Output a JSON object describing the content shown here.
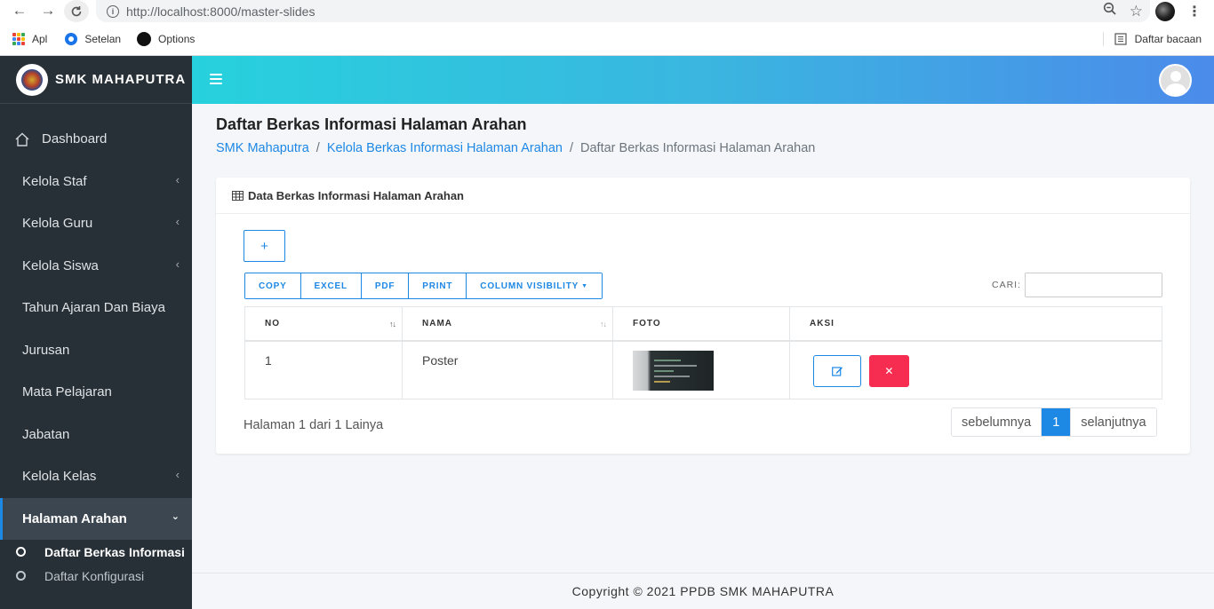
{
  "browser": {
    "url": "http://localhost:8000/master-slides",
    "bookmarks": [
      {
        "label": "Apl",
        "icon": "apps-icon"
      },
      {
        "label": "Setelan",
        "icon": "settings-icon"
      },
      {
        "label": "Options",
        "icon": "github-icon"
      }
    ],
    "reading_list": "Daftar bacaan"
  },
  "sidebar": {
    "brand": "SMK MAHAPUTRA",
    "items": [
      {
        "label": "Dashboard",
        "icon": "home-icon"
      },
      {
        "label": "Kelola Staf",
        "has_children": true
      },
      {
        "label": "Kelola Guru",
        "has_children": true
      },
      {
        "label": "Kelola Siswa",
        "has_children": true
      },
      {
        "label": "Tahun Ajaran Dan Biaya"
      },
      {
        "label": "Jurusan"
      },
      {
        "label": "Mata Pelajaran"
      },
      {
        "label": "Jabatan"
      },
      {
        "label": "Kelola Kelas",
        "has_children": true
      },
      {
        "label": "Halaman Arahan",
        "has_children": true,
        "active": true
      }
    ],
    "subitems": [
      {
        "label": "Daftar Berkas Informasi",
        "active": true
      },
      {
        "label": "Daftar Konfigurasi"
      }
    ]
  },
  "header": {
    "title": "Daftar Berkas Informasi Halaman Arahan",
    "breadcrumb": [
      "SMK Mahaputra",
      "Kelola Berkas Informasi Halaman Arahan",
      "Daftar Berkas Informasi Halaman Arahan"
    ]
  },
  "card": {
    "title": "Data Berkas Informasi Halaman Arahan",
    "add_label": "+",
    "export_buttons": [
      "COPY",
      "EXCEL",
      "PDF",
      "PRINT",
      "COLUMN VISIBILITY"
    ],
    "search_label": "CARI:",
    "search_value": "",
    "columns": [
      "NO",
      "NAMA",
      "FOTO",
      "AKSI"
    ],
    "rows": [
      {
        "no": "1",
        "nama": "Poster"
      }
    ],
    "info": "Halaman 1 dari 1 Lainya",
    "pagination": {
      "prev": "sebelumnya",
      "current": "1",
      "next": "selanjutnya"
    }
  },
  "footer": "Copyright © 2021 PPDB SMK MAHAPUTRA",
  "colors": {
    "accent": "#1e88e5",
    "danger": "#f62d51",
    "sidebar_bg": "#273037",
    "topbar_start": "#27d1dd",
    "topbar_end": "#4b8bea"
  }
}
